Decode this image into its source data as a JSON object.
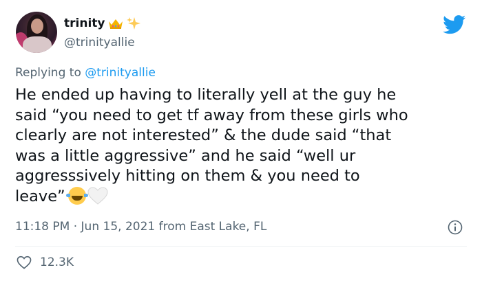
{
  "tweet": {
    "display_name": "trinity",
    "handle": "@trinityallie",
    "reply_prefix": "Replying to",
    "reply_to": "@trinityallie",
    "text": "He ended up having to literally yell at the guy he\nsaid “you need to get tf away from these girls who\nclearly are not interested” & the dude said “that\nwas a little aggressive” and he said “well ur\naggresssively hitting on them & you need to\nleave”",
    "time": "11:18 PM",
    "separator": "·",
    "date": "Jun 15, 2021",
    "location": "from East Lake, FL",
    "likes": "12.3K"
  },
  "colors": {
    "twitter_blue": "#1d9bf0",
    "secondary_text": "#536471",
    "primary_text": "#0f1419"
  },
  "icons": [
    "twitter-logo",
    "crown-emoji",
    "sparkles-emoji",
    "laughing-tears-emoji",
    "white-heart-emoji",
    "info-icon",
    "heart-icon"
  ]
}
